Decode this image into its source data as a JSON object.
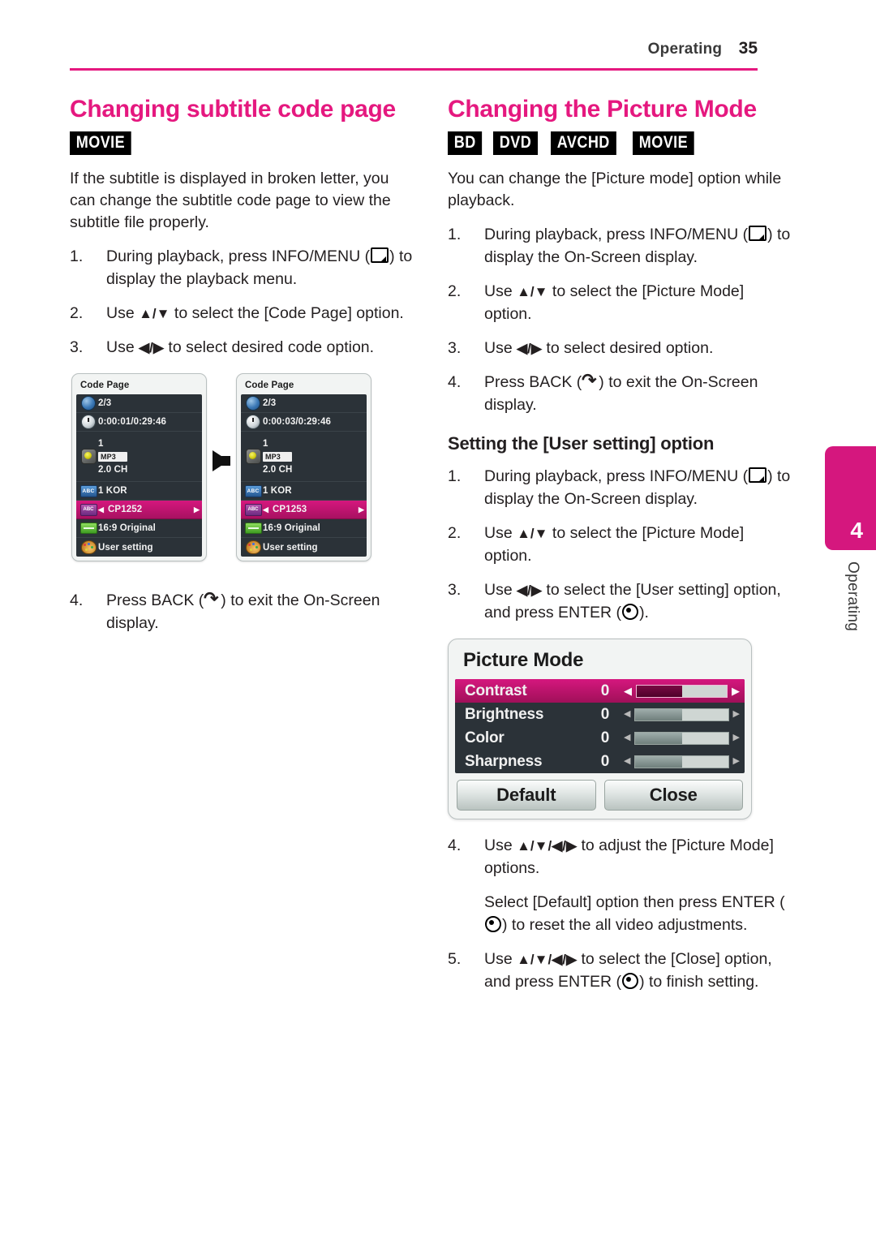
{
  "header": {
    "section": "Operating",
    "page_number": "35"
  },
  "side_tab": {
    "chapter_number": "4",
    "chapter_label": "Operating",
    "color": "#d5177e"
  },
  "theme": {
    "accent": "#e5187f",
    "badge_bg": "#000000",
    "osd_bg": "#2b3238",
    "osd_highlight": "#d5177e"
  },
  "left_column": {
    "title": "Changing subtitle code page",
    "badges": [
      "MOVIE"
    ],
    "intro": "If the subtitle is displayed in broken letter, you can change the subtitle code page to view the subtitle file properly.",
    "steps": [
      {
        "num": "1.",
        "pre": "During playback, press INFO/MENU (",
        "icon": "info-menu-icon",
        "post": ") to display the playback menu."
      },
      {
        "num": "2.",
        "pre": "Use ",
        "arrows": "▲/▼",
        "post": " to select the [Code Page] option."
      },
      {
        "num": "3.",
        "pre": "Use ",
        "arrows": "◀/▶",
        "post": " to select desired code option."
      }
    ],
    "final_step": {
      "num": "4.",
      "pre": "Press BACK (",
      "icon": "back-icon",
      "post": ") to exit the On-Screen display."
    }
  },
  "osd_code_page_before": {
    "title": "Code Page",
    "rows": [
      {
        "icon": "title-chapter-icon",
        "label": "2/3"
      },
      {
        "icon": "time-icon",
        "label": "0:00:01/0:29:46"
      },
      {
        "icon": "audio-icon",
        "lines": [
          "1",
          "MP3",
          "2.0 CH"
        ]
      },
      {
        "icon": "subtitle-icon",
        "label": "1 KOR"
      },
      {
        "icon": "code-page-icon",
        "label": "CP1252",
        "selected": true,
        "left_arrow": "◀",
        "right_arrow": "▶"
      },
      {
        "icon": "aspect-ratio-icon",
        "label": "16:9 Original"
      },
      {
        "icon": "picture-mode-icon",
        "label": "User setting"
      }
    ]
  },
  "osd_code_page_after": {
    "title": "Code Page",
    "rows": [
      {
        "icon": "title-chapter-icon",
        "label": "2/3"
      },
      {
        "icon": "time-icon",
        "label": "0:00:03/0:29:46"
      },
      {
        "icon": "audio-icon",
        "lines": [
          "1",
          "MP3",
          "2.0 CH"
        ]
      },
      {
        "icon": "subtitle-icon",
        "label": "1 KOR"
      },
      {
        "icon": "code-page-icon",
        "label": "CP1253",
        "selected": true,
        "left_arrow": "◀",
        "right_arrow": "▶"
      },
      {
        "icon": "aspect-ratio-icon",
        "label": "16:9 Original"
      },
      {
        "icon": "picture-mode-icon",
        "label": "User setting"
      }
    ]
  },
  "right_column": {
    "title": "Changing the Picture Mode",
    "badges": [
      "BD",
      "DVD",
      "AVCHD",
      "MOVIE"
    ],
    "intro": "You can change the [Picture mode] option while playback.",
    "steps": [
      {
        "num": "1.",
        "pre": "During playback, press INFO/MENU (",
        "icon": "info-menu-icon",
        "post": ") to display the On-Screen display."
      },
      {
        "num": "2.",
        "pre": "Use ",
        "arrows": "▲/▼",
        "post": " to select the [Picture Mode] option."
      },
      {
        "num": "3.",
        "pre": "Use ",
        "arrows": "◀/▶",
        "post": " to select desired option."
      },
      {
        "num": "4.",
        "pre": "Press BACK (",
        "icon": "back-icon",
        "post": ") to exit the On-Screen display."
      }
    ],
    "sub_title": "Setting the [User setting] option",
    "sub_steps": [
      {
        "num": "1.",
        "pre": "During playback, press INFO/MENU (",
        "icon": "info-menu-icon",
        "post": ") to display the On-Screen display."
      },
      {
        "num": "2.",
        "pre": "Use ",
        "arrows": "▲/▼",
        "post": " to select the [Picture Mode] option."
      },
      {
        "num": "3.",
        "pre": "Use ",
        "arrows": "◀/▶",
        "post": " to select the [User setting] option, and press ENTER (",
        "icon": "enter-icon",
        "tail": ")."
      }
    ],
    "sub_steps_after": [
      {
        "num": "4.",
        "pre": "Use ",
        "arrows": "▲/▼/◀/▶",
        "post": " to adjust the [Picture Mode] options."
      },
      {
        "num": "",
        "note_pre": "Select [Default] option then press ENTER (",
        "icon": "enter-icon",
        "note_post": ") to reset the all video adjustments."
      },
      {
        "num": "5.",
        "pre": "Use ",
        "arrows": "▲/▼/◀/▶",
        "post": " to select the [Close] option, and press ENTER (",
        "icon": "enter-icon",
        "tail": ") to finish setting."
      }
    ]
  },
  "osd_picture_mode": {
    "title": "Picture Mode",
    "rows": [
      {
        "label": "Contrast",
        "value": "0",
        "fill_percent": 50,
        "selected": true,
        "left_arrow": "◀",
        "right_arrow": "▶"
      },
      {
        "label": "Brightness",
        "value": "0",
        "fill_percent": 50,
        "selected": false,
        "left_arrow": "◀",
        "right_arrow": "▶"
      },
      {
        "label": "Color",
        "value": "0",
        "fill_percent": 50,
        "selected": false,
        "left_arrow": "◀",
        "right_arrow": "▶"
      },
      {
        "label": "Sharpness",
        "value": "0",
        "fill_percent": 50,
        "selected": false,
        "left_arrow": "◀",
        "right_arrow": "▶"
      }
    ],
    "buttons": [
      "Default",
      "Close"
    ]
  }
}
